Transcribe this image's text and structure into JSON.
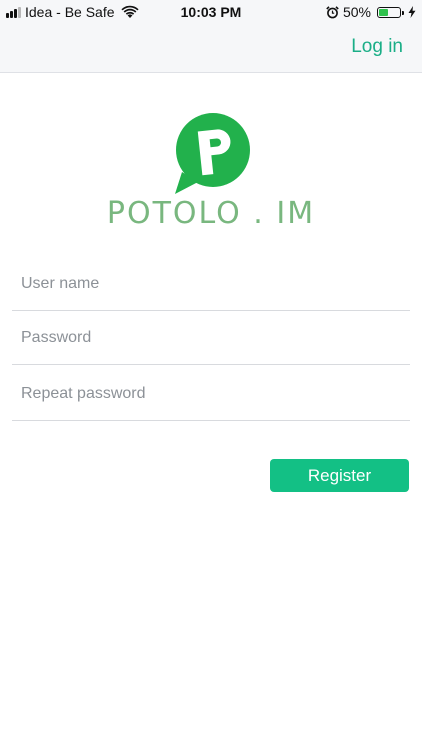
{
  "status_bar": {
    "carrier": "Idea - Be Safe",
    "time": "10:03 PM",
    "battery_percent_text": "50%",
    "battery_level": 0.5,
    "icons": [
      "signal-icon",
      "wifi-icon",
      "alarm-icon",
      "battery-icon",
      "charging-bolt-icon"
    ]
  },
  "header": {
    "login_label": "Log in"
  },
  "logo": {
    "wordmark": "POTOLO . IM",
    "icon": "potolo-logo-icon"
  },
  "form": {
    "username_placeholder": "User name",
    "password_placeholder": "Password",
    "repeat_password_placeholder": "Repeat password",
    "register_label": "Register"
  },
  "colors": {
    "accent": "#13c085",
    "link": "#1aae87",
    "logo_green": "#22b14c",
    "wordmark": "#79b77f"
  }
}
